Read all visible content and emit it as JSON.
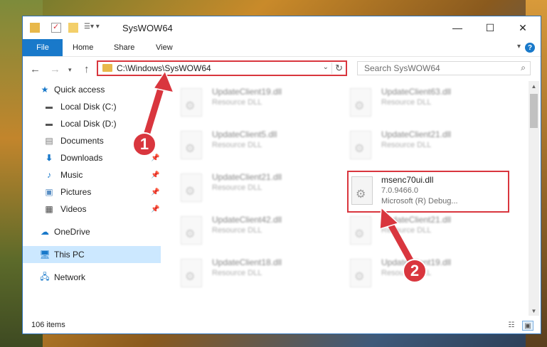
{
  "window": {
    "title": "SysWOW64",
    "controls": {
      "minimize": "—",
      "maximize": "☐",
      "close": "✕"
    }
  },
  "ribbon": {
    "tabs": [
      "File",
      "Home",
      "Share",
      "View"
    ],
    "help": "?"
  },
  "navigation": {
    "back": "←",
    "forward": "→",
    "up": "↑",
    "address": "C:\\Windows\\SysWOW64",
    "search_placeholder": "Search SysWOW64"
  },
  "sidebar": {
    "items": [
      {
        "label": "Quick access",
        "icon": "star-icon",
        "pinned": false
      },
      {
        "label": "Local Disk (C:)",
        "icon": "drive-icon",
        "pinned": false
      },
      {
        "label": "Local Disk (D:)",
        "icon": "drive-icon",
        "pinned": false
      },
      {
        "label": "Documents",
        "icon": "document-icon",
        "pinned": false
      },
      {
        "label": "Downloads",
        "icon": "download-icon",
        "pinned": true
      },
      {
        "label": "Music",
        "icon": "music-icon",
        "pinned": true
      },
      {
        "label": "Pictures",
        "icon": "picture-icon",
        "pinned": true
      },
      {
        "label": "Videos",
        "icon": "video-icon",
        "pinned": true
      },
      {
        "label": "OneDrive",
        "icon": "cloud-icon",
        "pinned": false
      },
      {
        "label": "This PC",
        "icon": "computer-icon",
        "pinned": false,
        "selected": true
      },
      {
        "label": "Network",
        "icon": "network-icon",
        "pinned": false
      }
    ]
  },
  "files": [
    {
      "name": "UpdateClient19.dll",
      "line2": "Resource DLL",
      "line3": ""
    },
    {
      "name": "UpdateClient63.dll",
      "line2": "Resource DLL",
      "line3": ""
    },
    {
      "name": "UpdateClient5.dll",
      "line2": "Resource DLL",
      "line3": ""
    },
    {
      "name": "UpdateClient21.dll",
      "line2": "Resource DLL",
      "line3": ""
    },
    {
      "name": "UpdateClient21.dll",
      "line2": "Resource DLL",
      "line3": ""
    },
    {
      "name": "msenc70ui.dll",
      "line2": "7.0.9466.0",
      "line3": "Microsoft (R) Debug...",
      "highlighted": true
    },
    {
      "name": "UpdateClient42.dll",
      "line2": "Resource DLL",
      "line3": ""
    },
    {
      "name": "UpdateClient21.dll",
      "line2": "Resource DLL",
      "line3": ""
    },
    {
      "name": "UpdateClient18.dll",
      "line2": "Resource DLL",
      "line3": ""
    },
    {
      "name": "UpdateClient19.dll",
      "line2": "Resource DLL",
      "line3": ""
    }
  ],
  "status": {
    "item_count": "106 items"
  },
  "callouts": [
    "1",
    "2"
  ],
  "colors": {
    "accent": "#1979ca",
    "highlight": "#d9363e",
    "selected": "#cce8ff"
  }
}
